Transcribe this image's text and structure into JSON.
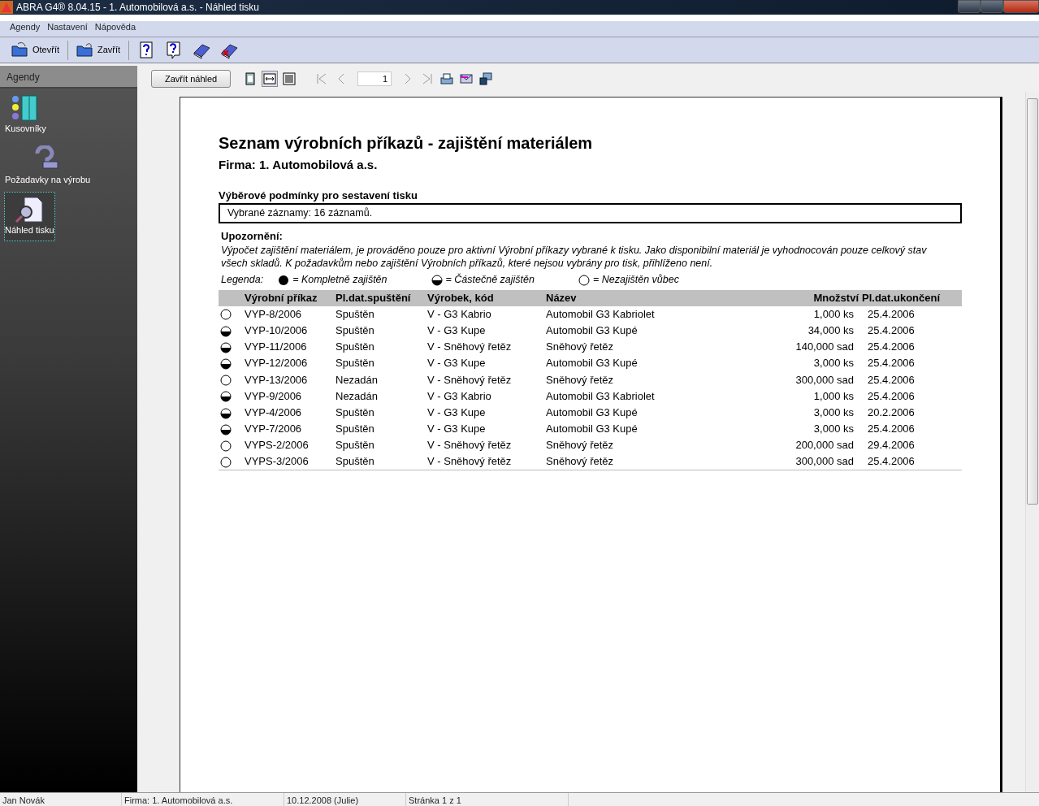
{
  "window": {
    "title": "ABRA G4® 8.04.15 - 1. Automobilová a.s. - Náhled tisku"
  },
  "menu": [
    "Agendy",
    "Nastavení",
    "Nápověda"
  ],
  "toolbar": [
    {
      "kind": "open",
      "label": "Otevřít"
    },
    {
      "kind": "close",
      "label": "Zavřít"
    },
    {
      "kind": "help"
    },
    {
      "kind": "helpbubble"
    },
    {
      "kind": "book"
    },
    {
      "kind": "bookx"
    }
  ],
  "sidebar": {
    "title": "Agendy",
    "items": [
      {
        "kind": "list",
        "label": "Kusovníky",
        "selected": false
      },
      {
        "kind": "request",
        "label": "Požadavky na výrobu",
        "selected": false
      },
      {
        "kind": "preview",
        "label": "Náhled tisku",
        "selected": true
      }
    ]
  },
  "preview_toolbar": {
    "close_button": "Zavřít náhled",
    "views": [
      {
        "kind": "page",
        "selected": false
      },
      {
        "kind": "width",
        "selected": true
      },
      {
        "kind": "lines",
        "selected": false
      }
    ],
    "page": "1"
  },
  "report": {
    "title": "Seznam výrobních příkazů - zajištění materiálem",
    "company": "Firma: 1. Automobilová a.s.",
    "conditions_heading": "Výběrové podmínky pro sestavení tisku",
    "conditions": "Vybrané záznamy: 16 záznamů.",
    "notice_heading": "Upozornění:",
    "notice": "Výpočet zajištění materiálem, je prováděno pouze pro aktivní Výrobní příkazy vybrané k tisku. Jako disponibilní materiál je vyhodnocován pouze celkový stav všech skladů. K požadavkům nebo zajištění Výrobních příkazů, které nejsou vybrány pro tisk, přihlíženo není.",
    "legend_label": "Legenda:",
    "legend": [
      {
        "kind": "full",
        "label": "= Kompletně zajištěn"
      },
      {
        "kind": "partial",
        "label": "= Částečně zajištěn"
      },
      {
        "kind": "none",
        "label": "= Nezajištěn vůbec"
      }
    ],
    "columns": [
      "Výrobní příkaz",
      "Pl.dat.spuštění",
      "Výrobek, kód",
      "Název",
      "Množství",
      "Pl.dat.ukončení"
    ],
    "rows": [
      {
        "kind": "none",
        "cells": [
          "VYP-8/2006",
          "Spuštěn",
          "V - G3 Kabrio",
          "Automobil G3 Kabriolet",
          "1,000 ks",
          "25.4.2006"
        ]
      },
      {
        "kind": "partial",
        "cells": [
          "VYP-10/2006",
          "Spuštěn",
          "V - G3 Kupe",
          "Automobil G3 Kupé",
          "34,000 ks",
          "25.4.2006"
        ]
      },
      {
        "kind": "partial",
        "cells": [
          "VYP-11/2006",
          "Spuštěn",
          "V - Sněhový řetěz",
          "Sněhový řetěz",
          "140,000 sad",
          "25.4.2006"
        ]
      },
      {
        "kind": "partial",
        "cells": [
          "VYP-12/2006",
          "Spuštěn",
          "V - G3 Kupe",
          "Automobil G3 Kupé",
          "3,000 ks",
          "25.4.2006"
        ]
      },
      {
        "kind": "none",
        "cells": [
          "VYP-13/2006",
          "Nezadán",
          "V - Sněhový řetěz",
          "Sněhový řetěz",
          "300,000 sad",
          "25.4.2006"
        ]
      },
      {
        "kind": "partial",
        "cells": [
          "VYP-9/2006",
          "Nezadán",
          "V - G3 Kabrio",
          "Automobil G3 Kabriolet",
          "1,000 ks",
          "25.4.2006"
        ]
      },
      {
        "kind": "partial",
        "cells": [
          "VYP-4/2006",
          "Spuštěn",
          "V - G3 Kupe",
          "Automobil G3 Kupé",
          "3,000 ks",
          "20.2.2006"
        ]
      },
      {
        "kind": "partial",
        "cells": [
          "VYP-7/2006",
          "Spuštěn",
          "V - G3 Kupe",
          "Automobil G3 Kupé",
          "3,000 ks",
          "25.4.2006"
        ]
      },
      {
        "kind": "none",
        "cells": [
          "VYPS-2/2006",
          "Spuštěn",
          "V - Sněhový řetěz",
          "Sněhový řetěz",
          "200,000 sad",
          "29.4.2006"
        ]
      },
      {
        "kind": "none",
        "cells": [
          "VYPS-3/2006",
          "Spuštěn",
          "V - Sněhový řetěz",
          "Sněhový řetěz",
          "300,000 sad",
          "25.4.2006"
        ]
      }
    ]
  },
  "status_bar": [
    "Jan Novák",
    "Firma: 1. Automobilová a.s.",
    "10.12.2008 (Julie)",
    "Stránka 1 z 1"
  ]
}
